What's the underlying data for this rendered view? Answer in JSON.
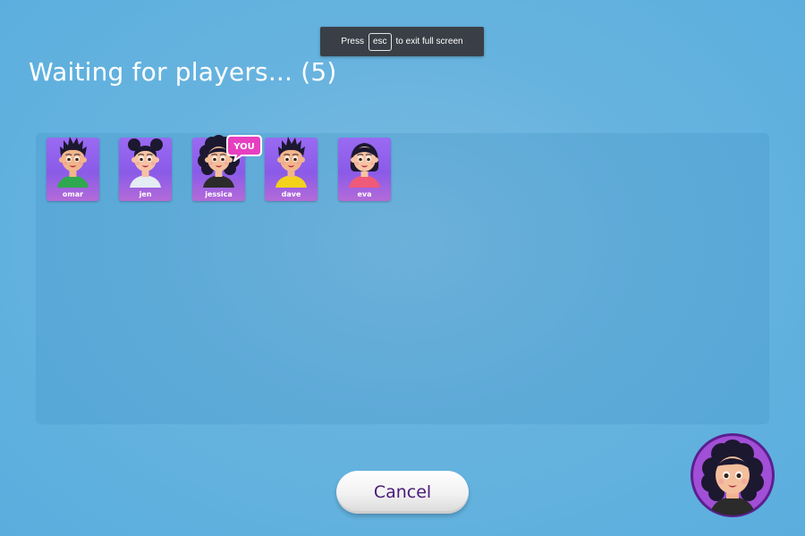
{
  "fullscreen_notice": {
    "prefix": "Press",
    "key": "esc",
    "suffix": "to exit full screen"
  },
  "lobby": {
    "title": "Waiting for players... (5)"
  },
  "players": [
    {
      "name": "omar",
      "shirt": "#2fa84f",
      "hair": "spiky",
      "skin": "#f2b58a"
    },
    {
      "name": "jen",
      "shirt": "#e4ecf4",
      "hair": "buns",
      "skin": "#f6c3a3"
    },
    {
      "name": "jessica",
      "shirt": "#2b2b2b",
      "hair": "curly",
      "skin": "#f3bf9c"
    },
    {
      "name": "dave",
      "shirt": "#f4d21c",
      "hair": "spiky",
      "skin": "#f2b58a"
    },
    {
      "name": "eva",
      "shirt": "#ef5a7a",
      "hair": "bob",
      "skin": "#f6c3a3"
    }
  ],
  "you_badge": "YOU",
  "cancel_label": "Cancel",
  "colors": {
    "card": "#9a6af2",
    "accent": "#e63fbf",
    "button_text": "#4b1a7a",
    "ring": "#5b1f8f"
  }
}
